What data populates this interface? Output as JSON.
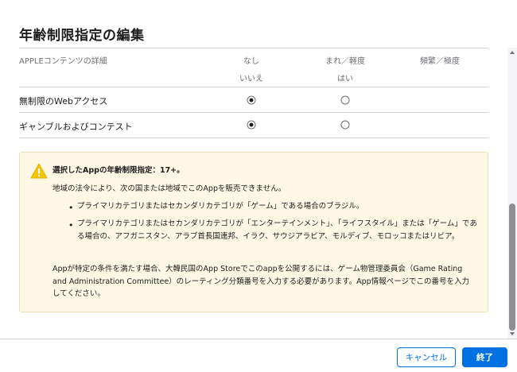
{
  "dialog": {
    "title": "年齢制限指定の編集"
  },
  "table": {
    "header_label": "APPLEコンテンツの詳細",
    "columns": [
      {
        "label": "なし",
        "sublabel": "いいえ"
      },
      {
        "label": "まれ／軽度",
        "sublabel": "はい"
      },
      {
        "label": "頻繁／極度",
        "sublabel": ""
      }
    ],
    "rows": [
      {
        "label": "無制限のWebアクセス",
        "selected": 0
      },
      {
        "label": "ギャンブルおよびコンテスト",
        "selected": 0
      }
    ]
  },
  "warning": {
    "icon": "warning-triangle-icon",
    "rating_line": "選択したAppの年齢制限指定：17+。",
    "legal_line": "地域の法令により、次の国または地域でこのAppを販売できません。",
    "bullets": [
      "プライマリカテゴリまたはセカンダリカテゴリが「ゲーム」である場合のブラジル。",
      "プライマリカテゴリまたはセカンダリカテゴリが「エンターテインメント」、「ライフスタイル」または「ゲーム」である場合の、アフガニスタン、アラブ首長国連邦、イラク、サウジアラビア、モルディブ、モロッコまたはリビア。"
    ],
    "korea_note": "Appが特定の条件を満たす場合、大韓民国のApp Storeでこのappを公開するには、ゲーム物管理委員会（Game Rating and Administration Committee）のレーティング分類番号を入力する必要があります。App情報ページでこの番号を入力してください。"
  },
  "footer": {
    "cancel_label": "キャンセル",
    "done_label": "終了"
  },
  "colors": {
    "accent": "#0071e3",
    "warning_bg": "#fdf7e4",
    "warning_icon": "#f5c400"
  }
}
